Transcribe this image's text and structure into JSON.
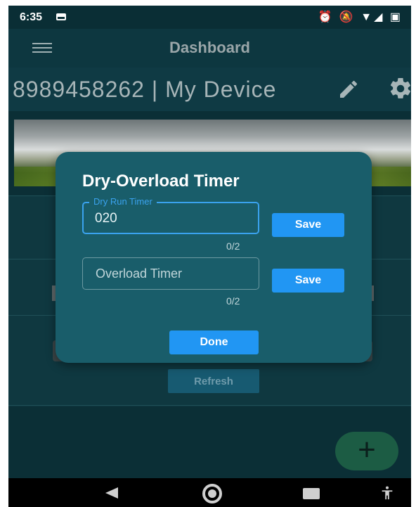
{
  "status_bar": {
    "time": "6:35",
    "right_icons": "⏰ 🔕 ▼◢ ▣"
  },
  "app_bar": {
    "title": "Dashboard"
  },
  "device": {
    "title": "8989458262 | My Device"
  },
  "main": {
    "refresh_label": "Refresh",
    "fab_label": "+"
  },
  "dialog": {
    "title": "Dry-Overload Timer",
    "dry_run": {
      "label": "Dry Run Timer",
      "value": "020",
      "counter": "0/2",
      "save_label": "Save"
    },
    "overload": {
      "placeholder": "Overload Timer",
      "counter": "0/2",
      "save_label": "Save"
    },
    "done_label": "Done"
  },
  "colors": {
    "accent": "#2196f3",
    "dialog_bg": "#195d6a",
    "app_bg": "#0b2f36",
    "fab": "#1c5c44"
  },
  "icons": [
    "menu-icon",
    "pencil-icon",
    "gear-icon",
    "back-icon",
    "home-icon",
    "recent-apps-icon",
    "accessibility-icon",
    "alarm-icon",
    "wifi-icon",
    "signal-icon",
    "battery-icon",
    "image-icon"
  ]
}
